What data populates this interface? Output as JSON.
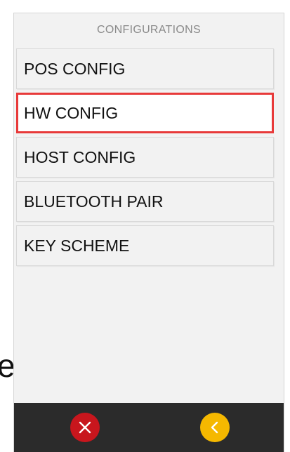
{
  "background_text": "e.",
  "screen": {
    "title": "CONFIGURATIONS",
    "menu_items": [
      {
        "label": "POS CONFIG",
        "selected": false
      },
      {
        "label": "HW CONFIG",
        "selected": true
      },
      {
        "label": "HOST CONFIG",
        "selected": false
      },
      {
        "label": "BLUETOOTH PAIR",
        "selected": false
      },
      {
        "label": "KEY SCHEME",
        "selected": false
      }
    ]
  },
  "footer": {
    "cancel_button": {
      "icon": "close-icon",
      "color": "#c8161d"
    },
    "back_button": {
      "icon": "chevron-left-icon",
      "color": "#f5b800"
    }
  },
  "colors": {
    "selection_border": "#e83a3a",
    "footer_bar": "#2b2b2b"
  }
}
